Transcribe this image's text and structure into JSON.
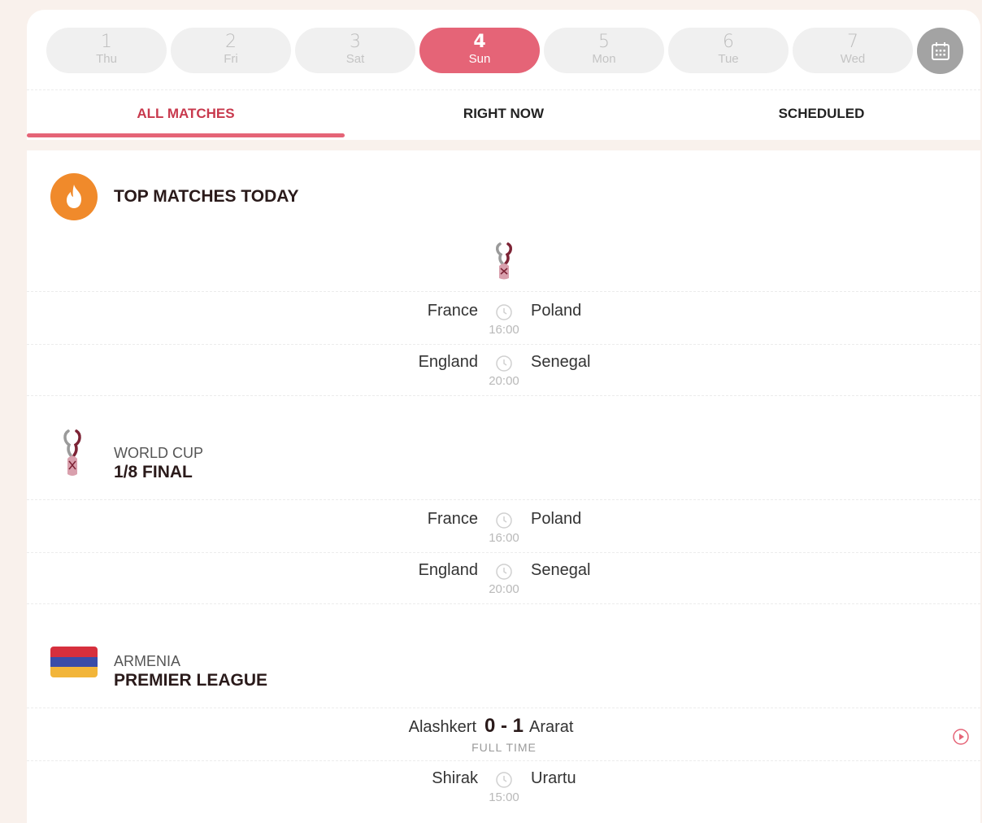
{
  "dates": [
    {
      "num": "1",
      "dow": "Thu"
    },
    {
      "num": "2",
      "dow": "Fri"
    },
    {
      "num": "3",
      "dow": "Sat"
    },
    {
      "num": "4",
      "dow": "Sun"
    },
    {
      "num": "5",
      "dow": "Mon"
    },
    {
      "num": "6",
      "dow": "Tue"
    },
    {
      "num": "7",
      "dow": "Wed"
    }
  ],
  "selected_date_index": 3,
  "calendar_icon": "calendar-icon",
  "tabs": [
    {
      "label": "ALL MATCHES"
    },
    {
      "label": "RIGHT NOW"
    },
    {
      "label": "SCHEDULED"
    }
  ],
  "active_tab_index": 0,
  "top_matches": {
    "title": "TOP MATCHES TODAY",
    "icon": "fire-icon",
    "matches": [
      {
        "home": "France",
        "away": "Poland",
        "time": "16:00"
      },
      {
        "home": "England",
        "away": "Senegal",
        "time": "20:00"
      }
    ]
  },
  "world_cup": {
    "competition": "WORLD CUP",
    "stage": "1/8 FINAL",
    "icon": "world-cup-trophy-icon",
    "matches": [
      {
        "home": "France",
        "away": "Poland",
        "time": "16:00"
      },
      {
        "home": "England",
        "away": "Senegal",
        "time": "20:00"
      }
    ]
  },
  "armenia": {
    "country": "ARMENIA",
    "league": "PREMIER LEAGUE",
    "flag_colors": [
      "#d62f3d",
      "#3a4ca8",
      "#f2b53a"
    ],
    "matches": [
      {
        "home": "Alashkert",
        "away": "Ararat",
        "score": "0 - 1",
        "status": "FULL TIME"
      },
      {
        "home": "Shirak",
        "away": "Urartu",
        "time": "15:00"
      }
    ]
  },
  "colors": {
    "accent": "#e56477",
    "accent_text": "#c8394d",
    "fire": "#f08a2b"
  }
}
